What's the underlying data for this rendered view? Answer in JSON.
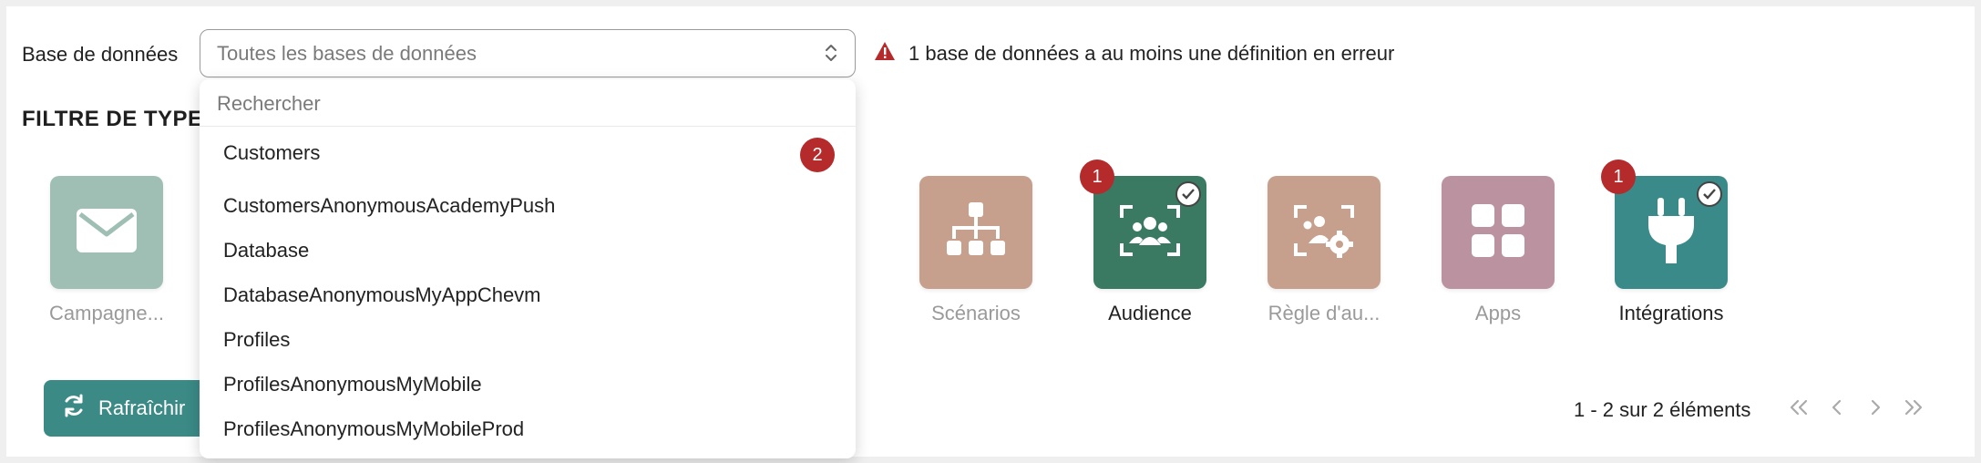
{
  "filters": {
    "database_label": "Base de données",
    "database_select_value": "Toutes les bases de données",
    "warning_text": "1 base de données a au moins une définition en erreur",
    "type_filter_title": "FILTRE DE TYPE D"
  },
  "dropdown": {
    "search_placeholder": "Rechercher",
    "options": [
      {
        "label": "Customers",
        "badge": "2"
      },
      {
        "label": "CustomersAnonymousAcademyPush"
      },
      {
        "label": "Database"
      },
      {
        "label": "DatabaseAnonymousMyAppChevm"
      },
      {
        "label": "Profiles"
      },
      {
        "label": "ProfilesAnonymousMyMobile"
      },
      {
        "label": "ProfilesAnonymousMyMobileProd"
      }
    ]
  },
  "tiles": [
    {
      "label": "Campagne...",
      "icon": "envelope-icon",
      "color": "#9fbfb4",
      "state": "dim"
    },
    {
      "label": "Scénarios",
      "icon": "hierarchy-icon",
      "color": "#c6a08c",
      "state": "dim"
    },
    {
      "label": "Audience",
      "icon": "audience-scan-icon",
      "color": "#3a7a62",
      "state": "active",
      "badge": "1",
      "checked": true
    },
    {
      "label": "Règle d'au...",
      "icon": "audience-gear-icon",
      "color": "#c6a08c",
      "state": "dim"
    },
    {
      "label": "Apps",
      "icon": "apps-grid-icon",
      "color": "#bb92a0",
      "state": "dim"
    },
    {
      "label": "Intégrations",
      "icon": "plug-icon",
      "color": "#3b8a8a",
      "state": "active",
      "badge": "1",
      "checked": true
    }
  ],
  "actions": {
    "refresh_label": "Rafraîchir"
  },
  "pagination": {
    "summary": "1 - 2 sur 2 éléments"
  },
  "colors": {
    "primary": "#3b8a86",
    "badge": "#b52a2a",
    "warning": "#b52a2a"
  }
}
